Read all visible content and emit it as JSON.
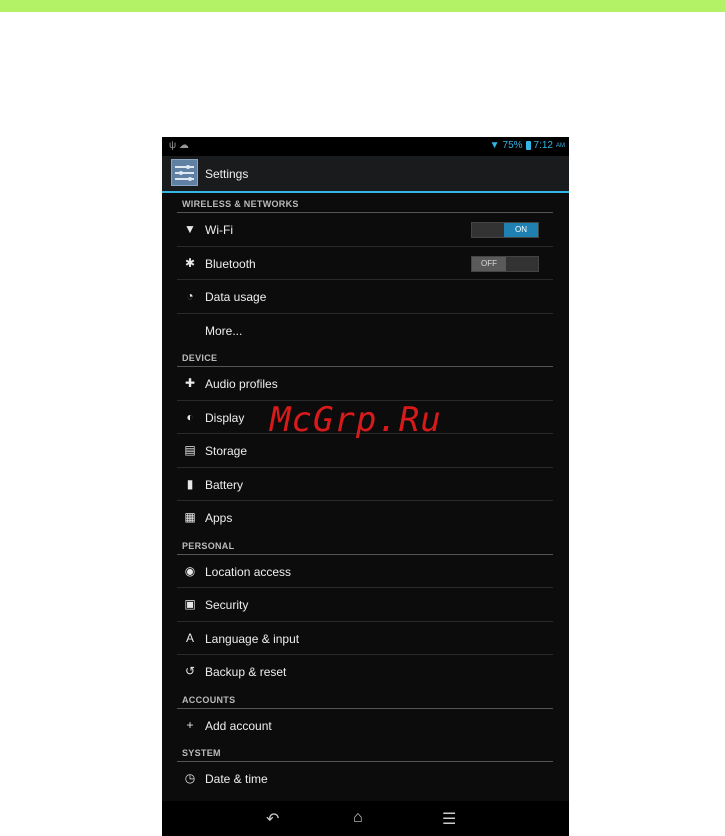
{
  "watermark": "McGrp.Ru",
  "status_bar": {
    "battery": "75%",
    "time": "7:12",
    "ampm": "AM"
  },
  "action_bar": {
    "title": "Settings"
  },
  "sections": [
    {
      "header": "WIRELESS & NETWORKS",
      "items": [
        {
          "icon": "wifi-icon",
          "label": "Wi-Fi",
          "toggle": "ON"
        },
        {
          "icon": "bluetooth-icon",
          "label": "Bluetooth",
          "toggle": "OFF"
        },
        {
          "icon": "data-usage-icon",
          "label": "Data usage"
        },
        {
          "icon": "",
          "label": "More..."
        }
      ]
    },
    {
      "header": "DEVICE",
      "items": [
        {
          "icon": "audio-profiles-icon",
          "label": "Audio profiles"
        },
        {
          "icon": "display-icon",
          "label": "Display"
        },
        {
          "icon": "storage-icon",
          "label": "Storage"
        },
        {
          "icon": "battery-icon",
          "label": "Battery"
        },
        {
          "icon": "apps-icon",
          "label": "Apps"
        }
      ]
    },
    {
      "header": "PERSONAL",
      "items": [
        {
          "icon": "location-icon",
          "label": "Location access"
        },
        {
          "icon": "lock-icon",
          "label": "Security"
        },
        {
          "icon": "language-icon",
          "label": "Language & input"
        },
        {
          "icon": "backup-icon",
          "label": "Backup & reset"
        }
      ]
    },
    {
      "header": "ACCOUNTS",
      "items": [
        {
          "icon": "plus-icon",
          "label": "Add account"
        }
      ]
    },
    {
      "header": "SYSTEM",
      "items": [
        {
          "icon": "clock-icon",
          "label": "Date & time"
        }
      ]
    }
  ],
  "colors": {
    "accent": "#33b5e5",
    "top_bar": "#b3f266",
    "toggle_on": "#1f81b1"
  }
}
